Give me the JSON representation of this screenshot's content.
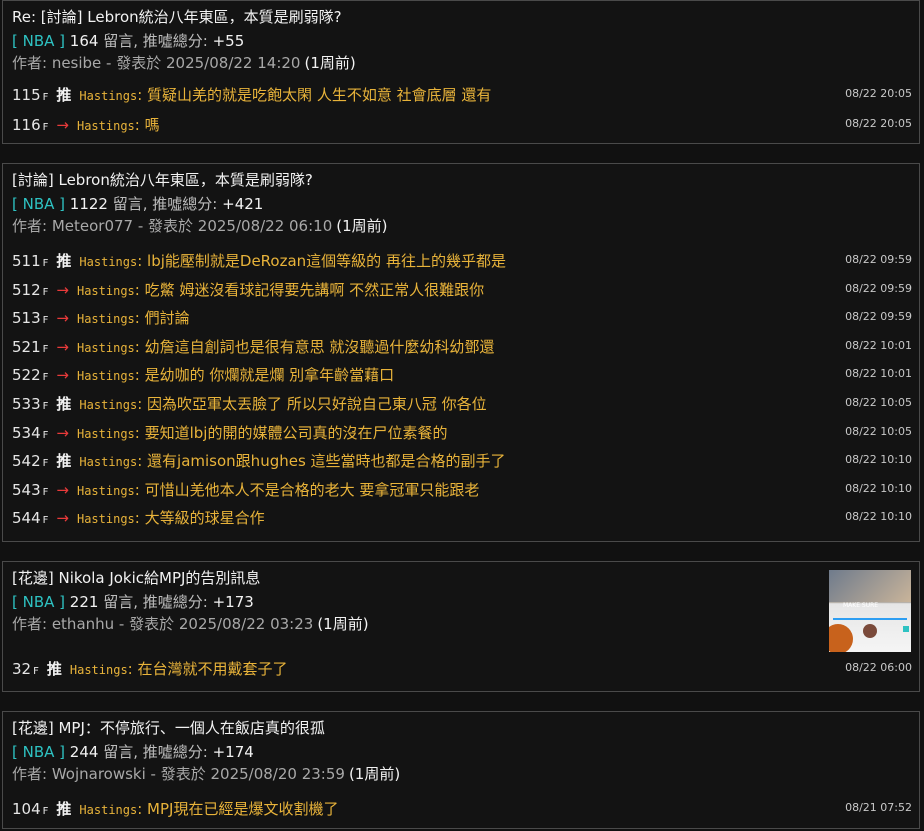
{
  "posts": [
    {
      "title": "Re: [討論] Lebron統治八年東區，本質是刷弱隊?",
      "board": "[ NBA ]",
      "count": "164",
      "count_label": "留言, 推噓總分:",
      "score": "+55",
      "author": "作者: nesibe - 發表於 2025/08/22 14:20",
      "ago": "(1周前)",
      "comments": [
        {
          "floor": "115",
          "tag": "推",
          "user": "Hastings",
          "text": "質疑山羌的就是吃飽太閑 人生不如意 社會底層 還有",
          "time": "08/22 20:05"
        },
        {
          "floor": "116",
          "tag": "→",
          "user": "Hastings",
          "text": "嗎",
          "time": "08/22 20:05"
        }
      ]
    },
    {
      "title": "[討論] Lebron統治八年東區，本質是刷弱隊?",
      "board": "[ NBA ]",
      "count": "1122",
      "count_label": "留言, 推噓總分:",
      "score": "+421",
      "author": "作者: Meteor077 - 發表於 2025/08/22 06:10",
      "ago": "(1周前)",
      "comments": [
        {
          "floor": "511",
          "tag": "推",
          "user": "Hastings",
          "text": "lbj能壓制就是DeRozan這個等級的 再往上的幾乎都是",
          "time": "08/22 09:59"
        },
        {
          "floor": "512",
          "tag": "→",
          "user": "Hastings",
          "text": "吃鱉 姆迷沒看球記得要先講啊 不然正常人很難跟你",
          "time": "08/22 09:59"
        },
        {
          "floor": "513",
          "tag": "→",
          "user": "Hastings",
          "text": "們討論",
          "time": "08/22 09:59"
        },
        {
          "floor": "521",
          "tag": "→",
          "user": "Hastings",
          "text": "幼詹這自創詞也是很有意思 就沒聽過什麼幼科幼鄧還",
          "time": "08/22 10:01"
        },
        {
          "floor": "522",
          "tag": "→",
          "user": "Hastings",
          "text": "是幼咖的 你爛就是爛 別拿年齡當藉口",
          "time": "08/22 10:01"
        },
        {
          "floor": "533",
          "tag": "推",
          "user": "Hastings",
          "text": "因為吹亞軍太丟臉了 所以只好說自己東八冠 你各位",
          "time": "08/22 10:05"
        },
        {
          "floor": "534",
          "tag": "→",
          "user": "Hastings",
          "text": "要知道lbj的開的媒體公司真的沒在尸位素餐的",
          "time": "08/22 10:05"
        },
        {
          "floor": "542",
          "tag": "推",
          "user": "Hastings",
          "text": "還有jamison跟hughes 這些當時也都是合格的副手了",
          "time": "08/22 10:10"
        },
        {
          "floor": "543",
          "tag": "→",
          "user": "Hastings",
          "text": "可惜山羌他本人不是合格的老大 要拿冠軍只能跟老",
          "time": "08/22 10:10"
        },
        {
          "floor": "544",
          "tag": "→",
          "user": "Hastings",
          "text": "大等級的球星合作",
          "time": "08/22 10:10"
        }
      ]
    },
    {
      "title": "[花邊] Nikola Jokic給MPJ的告別訊息",
      "board": "[ NBA ]",
      "count": "221",
      "count_label": "留言, 推噓總分:",
      "score": "+173",
      "author": "作者: ethanhu - 發表於 2025/08/22 03:23",
      "ago": "(1周前)",
      "thumb_text": "MAKE SURE",
      "comments": [
        {
          "floor": "32",
          "tag": "推",
          "user": "Hastings",
          "text": "在台灣就不用戴套子了",
          "time": "08/22 06:00"
        }
      ]
    },
    {
      "title": "[花邊] MPJ：不停旅行、一個人在飯店真的很孤",
      "board": "[ NBA ]",
      "count": "244",
      "count_label": "留言, 推噓總分:",
      "score": "+174",
      "author": "作者: Wojnarowski - 發表於 2025/08/20 23:59",
      "ago": "(1周前)",
      "comments": [
        {
          "floor": "104",
          "tag": "推",
          "user": "Hastings",
          "text": "MPJ現在已經是爆文收割機了",
          "time": "08/21 07:52"
        }
      ]
    }
  ],
  "floor_suffix": "F",
  "colors": {
    "board": "#2ec2c2",
    "arrow": "#e83a3a",
    "comment": "#e8b33a"
  }
}
